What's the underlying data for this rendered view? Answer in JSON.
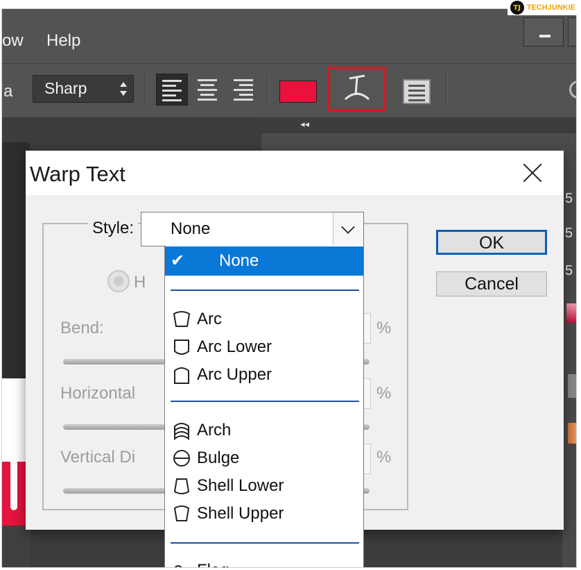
{
  "watermark": {
    "logo": "TJ",
    "brand": "TECHJUNKIE"
  },
  "menubar": {
    "items": [
      "ow",
      "Help"
    ]
  },
  "options_bar": {
    "label_fragment": "a",
    "anti_alias": "Sharp",
    "text_color": "#e8123c"
  },
  "panels": {
    "collapse_icon": "◂◂",
    "right_values": [
      "5",
      "5",
      "5"
    ]
  },
  "dialog": {
    "title": "Warp Text",
    "style_label": "Style:",
    "style_value": "None",
    "orientation_fragment": "H",
    "bend_label": "Bend:",
    "horizontal_label": "Horizontal",
    "vertical_label": "Vertical Di",
    "percent": "%",
    "ok_label": "OK",
    "cancel_label": "Cancel"
  },
  "dropdown": {
    "selected": "None",
    "groups": [
      [
        {
          "label": "None",
          "icon": "check-icon"
        }
      ],
      [
        {
          "label": "Arc",
          "icon": "arc-icon"
        },
        {
          "label": "Arc Lower",
          "icon": "arc-lower-icon"
        },
        {
          "label": "Arc Upper",
          "icon": "arc-upper-icon"
        }
      ],
      [
        {
          "label": "Arch",
          "icon": "arch-icon"
        },
        {
          "label": "Bulge",
          "icon": "bulge-icon"
        },
        {
          "label": "Shell Lower",
          "icon": "shell-lower-icon"
        },
        {
          "label": "Shell Upper",
          "icon": "shell-upper-icon"
        }
      ],
      [
        {
          "label": "Flag",
          "icon": "flag-icon"
        }
      ]
    ]
  }
}
